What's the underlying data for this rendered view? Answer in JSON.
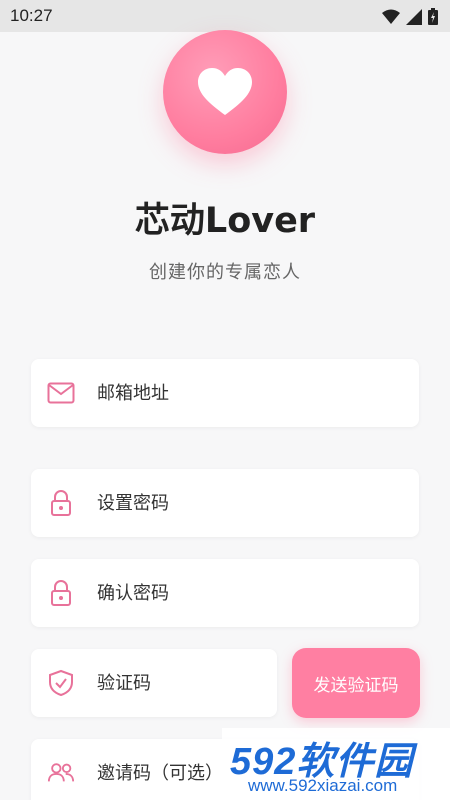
{
  "status_bar": {
    "time": "10:27",
    "icons": [
      "wifi-icon",
      "signal-icon",
      "battery-icon"
    ]
  },
  "app": {
    "logo_icon": "heart-icon",
    "title": "芯动Lover",
    "subtitle": "创建你的专属恋人"
  },
  "form": {
    "email": {
      "placeholder": "邮箱地址",
      "icon": "mail-icon"
    },
    "password": {
      "placeholder": "设置密码",
      "icon": "lock-icon"
    },
    "confirm_password": {
      "placeholder": "确认密码",
      "icon": "lock-icon"
    },
    "verify_code": {
      "placeholder": "验证码",
      "icon": "shield-check-icon"
    },
    "invite_code": {
      "placeholder": "邀请码（可选）",
      "icon": "users-icon"
    },
    "send_code_label": "发送验证码"
  },
  "watermark": {
    "text": "592软件园",
    "url": "www.592xiazai.com"
  },
  "colors": {
    "accent": "#ff7fa2",
    "icon": "#e8729a",
    "background": "#f7f7f8"
  }
}
